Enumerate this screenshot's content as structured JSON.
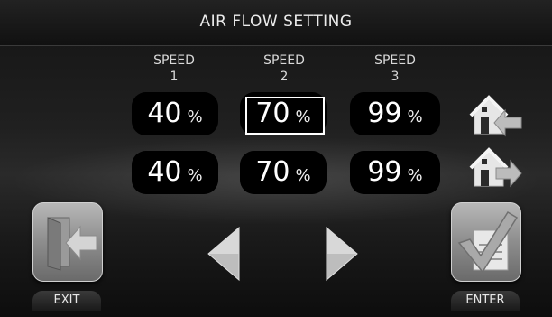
{
  "title": "AIR FLOW SETTING",
  "columns": [
    {
      "label": "SPEED",
      "number": "1"
    },
    {
      "label": "SPEED",
      "number": "2"
    },
    {
      "label": "SPEED",
      "number": "3"
    }
  ],
  "unit": "%",
  "rows": [
    {
      "values": [
        "40",
        "70",
        "99"
      ],
      "icon": "house-arrow-in-icon"
    },
    {
      "values": [
        "40",
        "70",
        "99"
      ],
      "icon": "house-arrow-out-icon"
    }
  ],
  "selected": {
    "row": 0,
    "column": 1
  },
  "buttons": {
    "exit_label": "EXIT",
    "enter_label": "ENTER",
    "exit_icon": "door-exit-icon",
    "enter_icon": "checkmark-document-icon",
    "prev_icon": "arrow-left-icon",
    "next_icon": "arrow-right-icon"
  }
}
